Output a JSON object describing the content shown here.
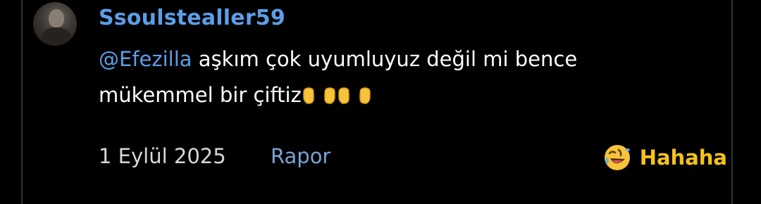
{
  "comment": {
    "author": "Ssoulstealler59",
    "mention": "@Efezilla",
    "text_line1": " aşkım çok uyumluyuz değil mi bence",
    "text_line2": "mükemmel bir çiftiz",
    "emojis": [
      "heart-hands-icon",
      "heart-hands-icon"
    ]
  },
  "footer": {
    "date": "1 Eylül 2025",
    "report_label": "Rapor",
    "reaction_label": "Hahaha",
    "reaction_icon": "rolling-laughing-icon"
  },
  "colors": {
    "background": "#000000",
    "author": "#5b9ee6",
    "link": "#7aa3d6",
    "reaction": "#f5c21b"
  }
}
